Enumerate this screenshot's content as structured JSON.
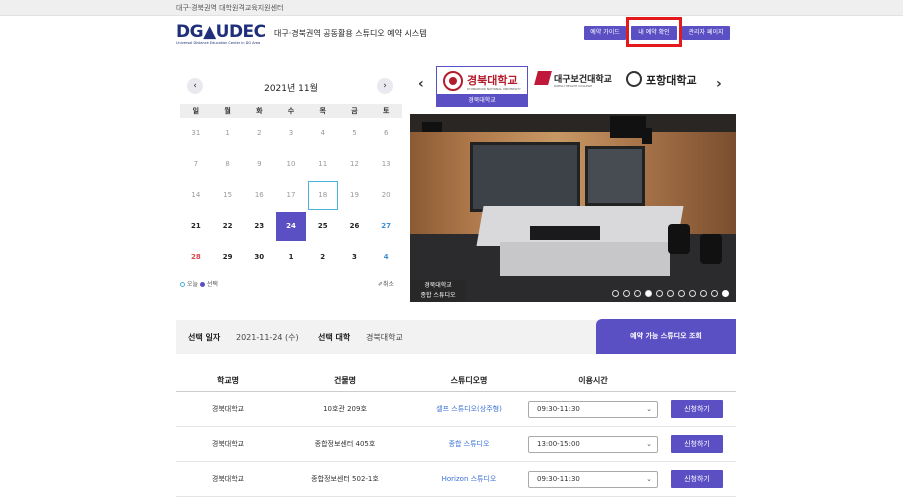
{
  "topbar": {
    "text": "대구·경북권역 대학원격교육지원센터"
  },
  "header": {
    "logo": "DG▲UDEC",
    "logo_sub": "Universal Distance Education Center in DG Area",
    "site_title": "대구·경북권역 공동활용 스튜디오 예약 시스템",
    "buttons": [
      "예약 가이드",
      "내 예약 확인",
      "관리자 페이지"
    ]
  },
  "calendar": {
    "title": "2021년 11월",
    "prev": "‹",
    "next": "›",
    "weekdays": [
      "일",
      "월",
      "화",
      "수",
      "목",
      "금",
      "토"
    ],
    "weeks": [
      [
        "31",
        "1",
        "2",
        "3",
        "4",
        "5",
        "6"
      ],
      [
        "7",
        "8",
        "9",
        "10",
        "11",
        "12",
        "13"
      ],
      [
        "14",
        "15",
        "16",
        "17",
        "18",
        "19",
        "20"
      ],
      [
        "21",
        "22",
        "23",
        "24",
        "25",
        "26",
        "27"
      ],
      [
        "28",
        "29",
        "30",
        "1",
        "2",
        "3",
        "4"
      ]
    ],
    "legend_today": "오늘",
    "legend_selected": "선택",
    "cancel": "취소"
  },
  "universities": {
    "prev": "‹",
    "next": "›",
    "items": [
      {
        "name": "경북대학교",
        "en": "KYUNGPOOK NATIONAL UNIVERSITY"
      },
      {
        "name": "대구보건대학교",
        "en": "DAEGU HEALTH COLLEGE"
      },
      {
        "name": "포항대학교",
        "en": ""
      }
    ],
    "active_tab": "경북대학교"
  },
  "photo": {
    "caption_line1": "경북대학교",
    "caption_line2": "종합 스튜디오"
  },
  "selection": {
    "date_label": "선택 일자",
    "date_value": "2021-11-24 (수)",
    "uni_label": "선택 대학",
    "uni_value": "경북대학교",
    "search_button": "예약 가능 스튜디오 조회"
  },
  "table": {
    "headers": [
      "학교명",
      "건물명",
      "스튜디오명",
      "이용시간",
      ""
    ],
    "rows": [
      {
        "school": "경북대학교",
        "building": "10호관 209호",
        "studio": "셀프 스튜디오(상주형)",
        "time": "09:30-11:30",
        "action": "신청하기"
      },
      {
        "school": "경북대학교",
        "building": "종합정보센터 405호",
        "studio": "종합 스튜디오",
        "time": "13:00-15:00",
        "action": "신청하기"
      },
      {
        "school": "경북대학교",
        "building": "종합정보센터 502-1호",
        "studio": "Horizon 스튜디오",
        "time": "09:30-11:30",
        "action": "신청하기"
      }
    ]
  }
}
